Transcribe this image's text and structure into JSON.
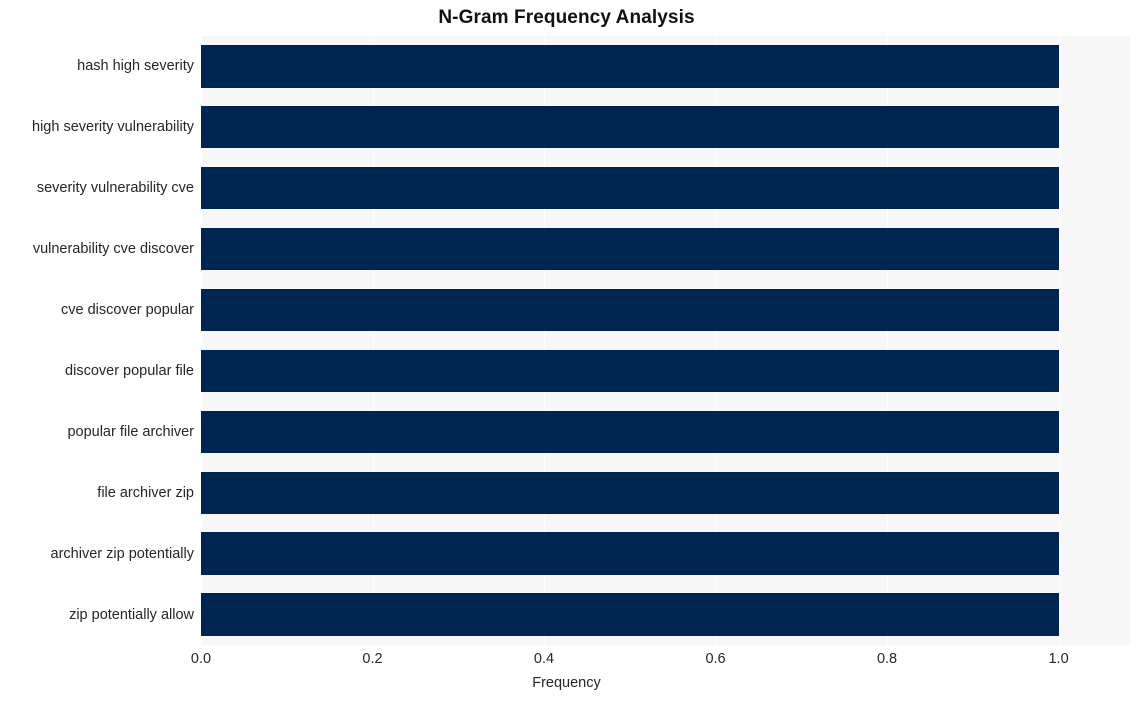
{
  "chart_data": {
    "type": "bar",
    "orientation": "horizontal",
    "title": "N-Gram Frequency Analysis",
    "xlabel": "Frequency",
    "ylabel": "",
    "xlim": [
      0.0,
      1.0833
    ],
    "xticks": [
      0.0,
      0.2,
      0.4,
      0.6,
      0.8,
      1.0
    ],
    "xticklabels": [
      "0.0",
      "0.2",
      "0.4",
      "0.6",
      "0.8",
      "1.0"
    ],
    "grid": true,
    "grid_axis": "x",
    "legend": false,
    "bar_color": "#002550",
    "plot_background": "#f7f7f8",
    "figure_background": "#ffffff",
    "categories": [
      "hash high severity",
      "high severity vulnerability",
      "severity vulnerability cve",
      "vulnerability cve discover",
      "cve discover popular",
      "discover popular file",
      "popular file archiver",
      "file archiver zip",
      "archiver zip potentially",
      "zip potentially allow"
    ],
    "values": [
      1.0,
      1.0,
      1.0,
      1.0,
      1.0,
      1.0,
      1.0,
      1.0,
      1.0,
      1.0
    ]
  }
}
